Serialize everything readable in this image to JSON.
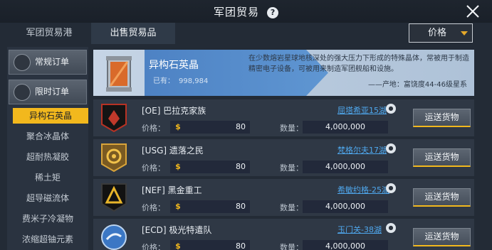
{
  "header": {
    "title": "军团贸易",
    "help_glyph": "?"
  },
  "tabs": [
    {
      "label": "军团贸易港"
    },
    {
      "label": "出售贸易品"
    }
  ],
  "sort": {
    "label": "价格"
  },
  "sidebar": {
    "categories": [
      {
        "label": "常规订单",
        "icon": "regular-order-icon"
      },
      {
        "label": "限时订单",
        "icon": "timed-order-icon"
      }
    ],
    "items": [
      {
        "label": "异构石英晶",
        "active": true
      },
      {
        "label": "聚合冰晶体",
        "active": false
      },
      {
        "label": "超耐热凝胶",
        "active": false
      },
      {
        "label": "稀土矩",
        "active": false
      },
      {
        "label": "超导磁流体",
        "active": false
      },
      {
        "label": "费米子冷凝物",
        "active": false
      },
      {
        "label": "浓缩超铀元素",
        "active": false
      }
    ]
  },
  "banner": {
    "name": "异构石英晶",
    "own_label": "已有：",
    "own_value": "998,984",
    "description": "在少数熔岩星球地核深处的强大压力下形成的特殊晶体，常被用于制造精密电子设备，可被用来制造军团舰船和设施。",
    "origin": "——产地：富饶度44-46级星系"
  },
  "orders": [
    {
      "corp": "[OE] 巴拉克家族",
      "location": "屈塔希亚15湖",
      "price": "80",
      "quantity": "4,000,000",
      "emblem": "oe-emblem-icon"
    },
    {
      "corp": "[USG] 遗落之民",
      "location": "梵格尔夫17湖",
      "price": "80",
      "quantity": "4,000,000",
      "emblem": "usg-emblem-icon"
    },
    {
      "corp": "[NEF] 黑金重工",
      "location": "希敏约格-25湖",
      "price": "80",
      "quantity": "4,000,000",
      "emblem": "nef-emblem-icon"
    },
    {
      "corp": "[ECD] 极光特遣队",
      "location": "玉门关-38湖",
      "price": "80",
      "quantity": "4,000,000",
      "emblem": "ecd-emblem-icon"
    }
  ],
  "labels": {
    "price": "价格：",
    "quantity": "数量：",
    "ship_button": "运送货物",
    "coin_glyph": "$",
    "pin_glyph": "●"
  },
  "colors": {
    "accent": "#f2b81d",
    "link": "#4fa8ee",
    "banner_blue": "#4d82c4"
  }
}
